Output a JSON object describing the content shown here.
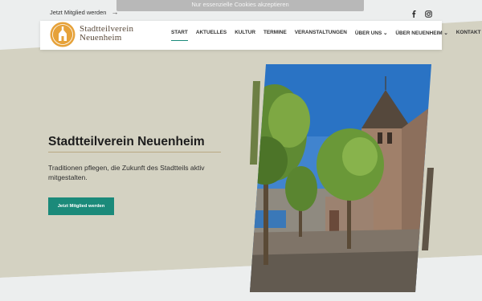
{
  "topbar": {
    "join_label": "Jetzt Mitglied werden",
    "join_arrow": "→"
  },
  "social": [
    "facebook-icon",
    "instagram-icon"
  ],
  "cookie": {
    "accept_label": "Nur essenzielle Cookies akzeptieren"
  },
  "brand": {
    "line1": "Stadtteilverein",
    "line2": "Neuenheim"
  },
  "nav": {
    "items": [
      {
        "label": "START"
      },
      {
        "label": "AKTUELLES"
      },
      {
        "label": "KULTUR"
      },
      {
        "label": "TERMINE"
      },
      {
        "label": "VERANSTALTUNGEN"
      },
      {
        "label": "ÜBER UNS ⌄"
      },
      {
        "label": "ÜBER NEUENHEIM ⌄"
      },
      {
        "label": "KONTAKT"
      }
    ]
  },
  "hero": {
    "title": "Stadtteilverein Neuenheim",
    "subtitle": "Traditionen pflegen, die Zukunft des Stadtteils aktiv mitgestalten.",
    "button_label": "Jetzt Mitglied werden"
  },
  "colors": {
    "accent": "#1b8a7a",
    "beige": "#d4d2c2",
    "logo": "#e6a23a"
  }
}
